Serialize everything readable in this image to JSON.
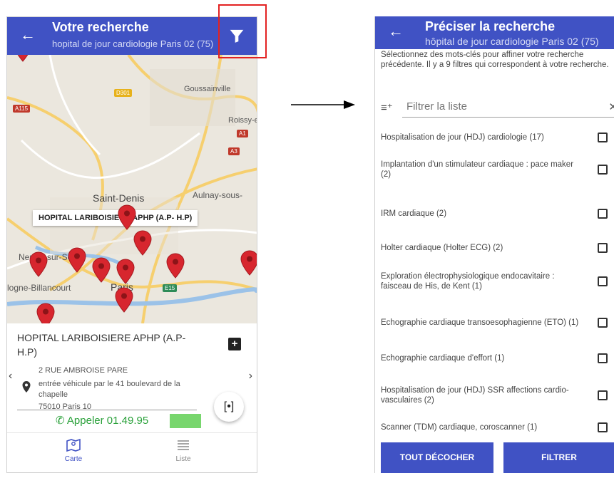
{
  "left_screen": {
    "header": {
      "title": "Votre recherche",
      "subtitle": "hopital de jour cardiologie Paris 02 (75)",
      "filter_icon": "filter-funnel-icon"
    },
    "map": {
      "places": [
        "Goussainville",
        "Roissy-en-",
        "Saint-Denis",
        "Aulnay-sous-",
        "Neuilly-sur-Seine",
        "Paris",
        "logne-Billancourt"
      ],
      "road_tags": [
        "D301",
        "A115",
        "A1",
        "A3",
        "E15"
      ],
      "selected_label": "HOPITAL LARIBOISIERE APHP (A.P- H.P)"
    },
    "card": {
      "name": "HOPITAL LARIBOISIERE APHP (A.P- H.P)",
      "address_line1": "2 RUE AMBROISE PARE",
      "address_line2": "entrée véhicule par le 41 boulevard de la chapelle",
      "address_line3": "75010 Paris 10",
      "call_label": "Appeler 01.49.95"
    },
    "bottom_nav": {
      "map_label": "Carte",
      "list_label": "Liste"
    }
  },
  "right_screen": {
    "header": {
      "title": "Préciser la recherche",
      "subtitle": "hôpital de jour cardiologie Paris 02 (75)"
    },
    "intro": "Sélectionnez des mots-clés pour affiner votre recherche précédente. Il y a 9 filtres qui correspondent à votre recherche.",
    "filter_placeholder": "Filtrer la liste",
    "options": [
      {
        "label": "Hospitalisation de jour (HDJ) cardiologie (17)",
        "checked": false
      },
      {
        "label": "Implantation d'un stimulateur cardiaque : pace maker (2)",
        "checked": false
      },
      {
        "label": "IRM cardiaque (2)",
        "checked": false
      },
      {
        "label": "Holter cardiaque (Holter ECG) (2)",
        "checked": false
      },
      {
        "label": "Exploration électrophysiologique endocavitaire : faisceau de His, de Kent (1)",
        "checked": false
      },
      {
        "label": "Echographie cardiaque transoesophagienne (ETO) (1)",
        "checked": false
      },
      {
        "label": "Echographie cardiaque d'effort (1)",
        "checked": false
      },
      {
        "label": "Hospitalisation de jour (HDJ) SSR affections cardio-vasculaires (2)",
        "checked": false
      },
      {
        "label": "Scanner (TDM) cardiaque, coroscanner (1)",
        "checked": false
      }
    ],
    "buttons": {
      "uncheck_all": "TOUT DÉCOCHER",
      "apply": "FILTRER"
    }
  },
  "colors": {
    "header_blue": "#4052c4",
    "pin_red": "#d7262e",
    "call_green": "#2aa13a",
    "highlight_red": "#e32222"
  }
}
